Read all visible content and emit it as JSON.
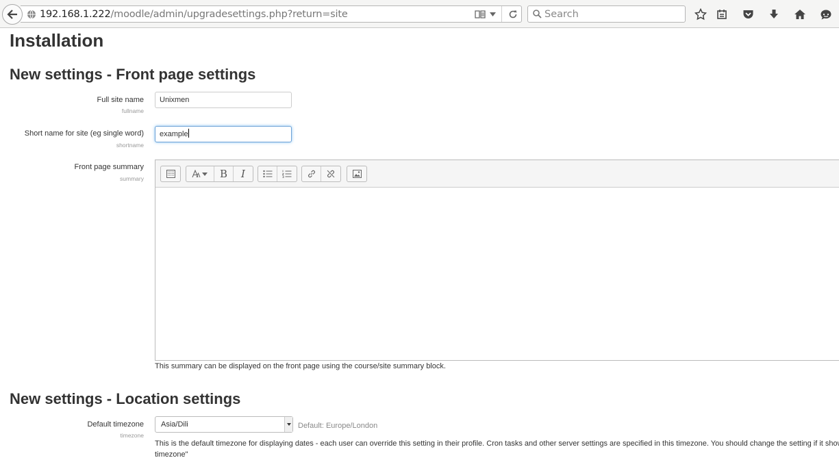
{
  "browser": {
    "url_host": "192.168.1.222",
    "url_path": "/moodle/admin/upgradesettings.php?return=site",
    "search_placeholder": "Search"
  },
  "page": {
    "title": "Installation"
  },
  "front_page_section": {
    "heading": "New settings - Front page settings",
    "fullname": {
      "label": "Full site name",
      "sublabel": "fullname",
      "value": "Unixmen"
    },
    "shortname": {
      "label": "Short name for site (eg single word)",
      "sublabel": "shortname",
      "value": "example"
    },
    "summary": {
      "label": "Front page summary",
      "sublabel": "summary",
      "help": "This summary can be displayed on the front page using the course/site summary block."
    }
  },
  "location_section": {
    "heading": "New settings - Location settings",
    "timezone": {
      "label": "Default timezone",
      "sublabel": "timezone",
      "value": "Asia/Dili",
      "default_note": "Default: Europe/London",
      "help_line1": "This is the default timezone for displaying dates - each user can override this setting in their profile. Cron tasks and other server settings are specified in this timezone. You should change the setting if it shows as \"Invalid",
      "help_line2": "timezone\""
    }
  }
}
